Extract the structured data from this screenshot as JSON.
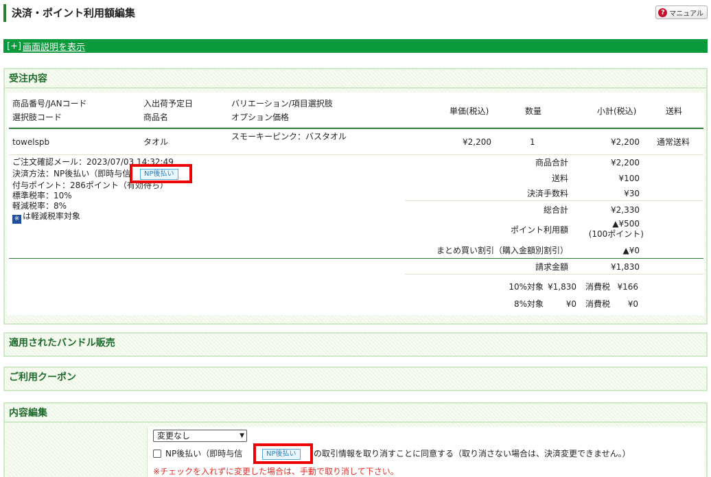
{
  "header": {
    "title": "決済・ポイント利用額編集",
    "manual_label": "マニュアル"
  },
  "help": {
    "bracket": "[+]",
    "link": "画面説明を表示"
  },
  "order": {
    "title": "受注内容",
    "columns": {
      "product_no": "商品番号/JANコード",
      "option_code": "選択肢コード",
      "ship_date": "入出荷予定日",
      "product_name": "商品名",
      "variation": "バリエーション/項目選択肢",
      "option_price": "オプション価格",
      "unit_price": "単価(税込)",
      "qty": "数量",
      "subtotal": "小計(税込)",
      "shipping": "送料"
    },
    "item": {
      "product_no": "towelspb",
      "product_name": "タオル",
      "variation": "スモーキーピンク：バスタオル",
      "unit_price": "¥2,200",
      "qty": "1",
      "subtotal": "¥2,200",
      "shipping": "通常送料"
    },
    "info": {
      "confirm_mail": "ご注文確認メール：2023/07/03 14:32:49",
      "payment_method": "決済方法：NP後払い（即時与信",
      "np_badge": "NP後払い",
      "points": "付与ポイント：286ポイント（有効待ち）",
      "std_tax": "標準税率：10%",
      "reduced_tax": "軽減税率：8%",
      "reduced_mark": "※",
      "reduced_note": "は軽減税率対象"
    },
    "totals": {
      "product_total_label": "商品合計",
      "product_total": "¥2,200",
      "shipping_label": "送料",
      "shipping": "¥100",
      "fee_label": "決済手数料",
      "fee": "¥30",
      "grand_label": "総合計",
      "grand": "¥2,330",
      "point_label": "ポイント利用額",
      "point_value": "▲¥500",
      "point_sub": "(100ポイント)",
      "bulk_label": "まとめ買い割引（購入金額別割引）",
      "bulk_value": "▲¥0",
      "bill_label": "請求金額",
      "bill": "¥1,830"
    },
    "tax_rows": [
      {
        "label": "10%対象",
        "base": "¥1,830",
        "tax_label": "消費税",
        "tax": "¥166"
      },
      {
        "label": "8%対象",
        "base": "¥0",
        "tax_label": "消費税",
        "tax": "¥0"
      }
    ]
  },
  "bundle": {
    "title": "適用されたバンドル販売"
  },
  "coupon": {
    "title": "ご利用クーポン"
  },
  "edit": {
    "title": "内容編集",
    "select_value": "変更なし",
    "cb_prefix": "NP後払い（即時与信",
    "np_badge": "NP後払い",
    "cb_suffix": "の取引情報を取り消すことに同意する（取り消さない場合は、決済変更できません。）",
    "warning": "※チェックを入れずに変更した場合は、手動で取り消して下さい。"
  },
  "colors": {
    "accent_green": "#0a9a3c",
    "section_title": "#1c6b2b",
    "highlight_red": "#ee0000",
    "warning_red": "#e0302a"
  }
}
